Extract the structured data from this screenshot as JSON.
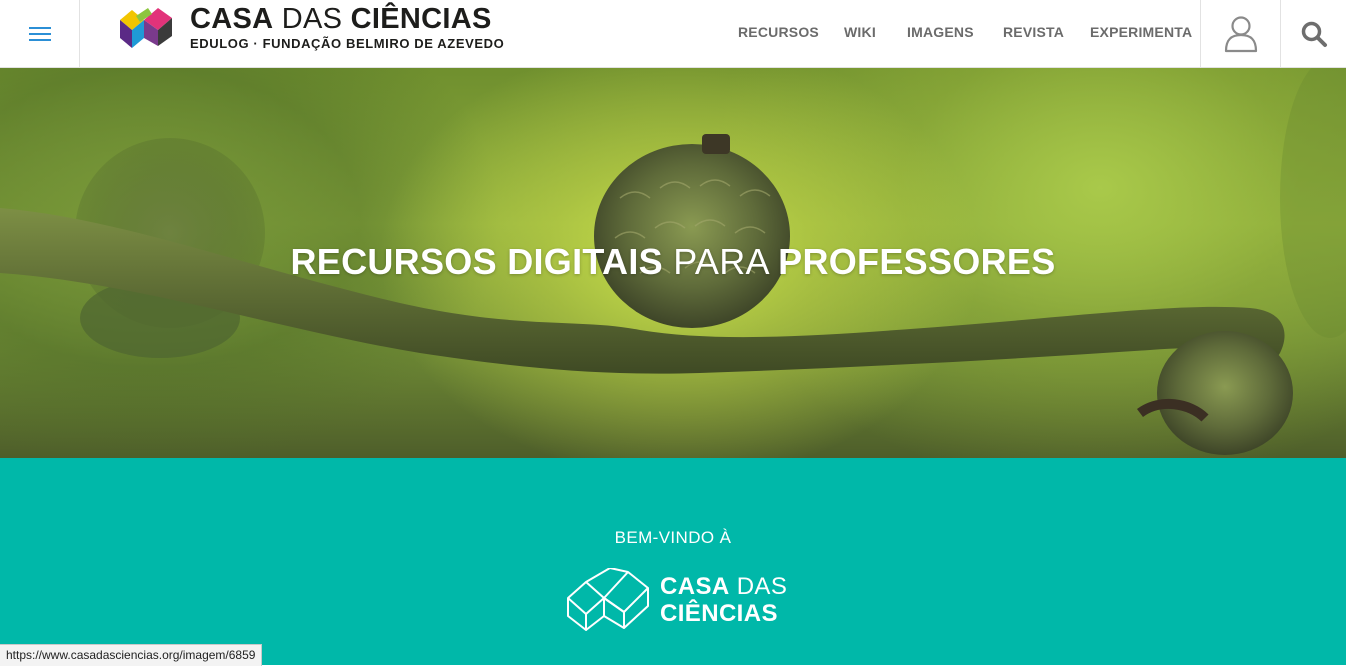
{
  "header": {
    "brand_title_bold_1": "CASA",
    "brand_title_regular": "DAS",
    "brand_title_bold_2": "CIÊNCIAS",
    "brand_subtitle": "EDULOG · FUNDAÇÃO BELMIRO DE AZEVEDO",
    "nav": [
      "RECURSOS",
      "WIKI",
      "IMAGENS",
      "REVISTA",
      "EXPERIMENTA"
    ],
    "menu_icon": "hamburger-icon",
    "user_icon": "user-icon",
    "search_icon": "search-icon"
  },
  "hero": {
    "title_part1": "RECURSOS DIGITAIS",
    "title_part2": "PARA",
    "title_part3": "PROFESSORES"
  },
  "welcome": {
    "label": "BEM-VINDO À",
    "logo_line1_bold": "CASA",
    "logo_line1_regular": "DAS",
    "logo_line2_bold": "CIÊNCIAS"
  },
  "status_bar": {
    "url": "https://www.casadasciencias.org/imagem/6859"
  },
  "colors": {
    "accent_teal": "#00b8a9",
    "nav_text": "#6b6b6b",
    "menu_icon": "#2b8fd6"
  }
}
